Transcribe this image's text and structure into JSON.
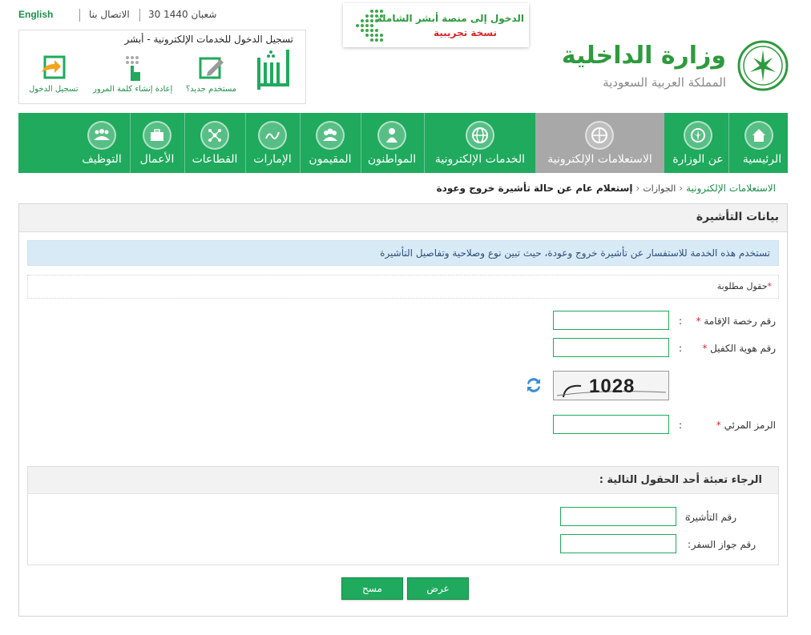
{
  "top_links": {
    "english": "English",
    "contact": "الاتصال بنا",
    "date": "30 شعبان 1440"
  },
  "absher": {
    "title": "تسجيل الدخول للخدمات الإلكترونية - أبشر",
    "logo_text": "أبشر",
    "login": "تسجيل الدخول",
    "reset_password": "إعادة إنشاء كلمة المرور",
    "new_user": "مستخدم جديد؟"
  },
  "trial_banner": {
    "line1": "الدخول إلى منصة أبشر الشاملة",
    "line2": "نسخة تجريبية"
  },
  "ministry": {
    "name": "وزارة الداخلية",
    "country": "المملكة العربية السعودية"
  },
  "nav": {
    "items": [
      {
        "label": "الرئيسية",
        "icon": "home-icon"
      },
      {
        "label": "عن الوزارة",
        "icon": "emblem-icon"
      },
      {
        "label": "الاستعلامات الإلكترونية",
        "icon": "globe-search-icon",
        "active": true
      },
      {
        "label": "الخدمات الإلكترونية",
        "icon": "globe-icon"
      },
      {
        "label": "المواطنون",
        "icon": "citizen-icon"
      },
      {
        "label": "المقيمون",
        "icon": "people-icon"
      },
      {
        "label": "الإمارات",
        "icon": "calligraphy-icon"
      },
      {
        "label": "القطاعات",
        "icon": "network-icon"
      },
      {
        "label": "الأعمال",
        "icon": "briefcase-icon"
      },
      {
        "label": "التوظيف",
        "icon": "team-icon"
      }
    ]
  },
  "breadcrumb": {
    "level1": "الاستعلامات الإلكترونية",
    "level2": "الجوازات",
    "current": "إستعلام عام عن حالة تأشيرة خروج وعودة"
  },
  "form": {
    "panel_title": "بيانات التأشيرة",
    "info": "تستخدم هذه الخدمة للاستفسار عن تأشيرة خروج وعودة، حيث تبين نوع وصلاحية وتفاصيل التأشيرة",
    "required_note": "حقول مطلوبة",
    "required_star": "*",
    "colon": ":",
    "iqama_label": "رقم رخصة الإقامة",
    "iqama_value": "",
    "sponsor_label": "رقم هوية الكفيل",
    "sponsor_value": "",
    "captcha_text": "1028",
    "visual_code_label": "الرمز المرئي",
    "visual_code_value": "",
    "sub_title": "الرجاء تعبئة أحد الحقول التالية :",
    "visa_label": "رقم التأشيرة",
    "visa_value": "",
    "passport_label": "رقم جواز السفر",
    "passport_value": "",
    "show_button": "عرض",
    "clear_button": "مسح"
  },
  "colors": {
    "primary_green": "#1faa5d",
    "active_gray": "#a8a8a8",
    "info_bg": "#d9eaf7",
    "required_red": "#d9262c"
  }
}
